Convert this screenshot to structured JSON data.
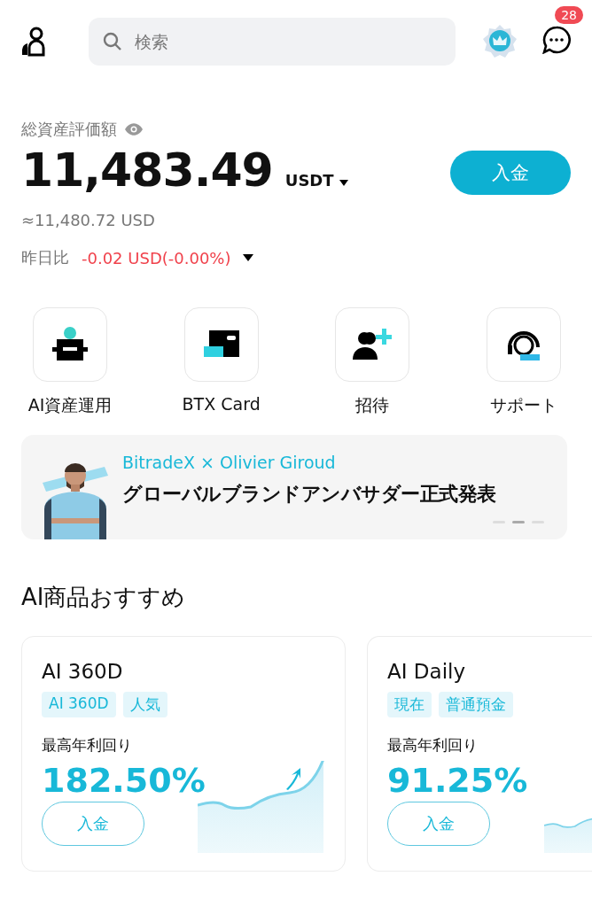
{
  "header": {
    "search": {
      "placeholder": "検索"
    },
    "notification_count": "28"
  },
  "balance": {
    "label": "総資産評価額",
    "amount": "11,483.49",
    "currency": "USDT",
    "approx": "≈11,480.72 USD",
    "change_label": "昨日比",
    "change": "-0.02 USD(-0.00%)",
    "deposit_button": "入金"
  },
  "shortcuts": [
    {
      "kind": "robot",
      "label": "AI資産運用"
    },
    {
      "kind": "card",
      "label": "BTX Card"
    },
    {
      "kind": "invite",
      "label": "招待"
    },
    {
      "kind": "support",
      "label": "サポート"
    }
  ],
  "banner": {
    "title": "BitradeX × Olivier Giroud",
    "subtitle": "グローバルブランドアンバサダー正式発表",
    "dots": [
      {
        "selected": false
      },
      {
        "selected": true
      },
      {
        "selected": false
      }
    ]
  },
  "section_title": "AI商品おすすめ",
  "products": [
    {
      "name": "AI 360D",
      "tags": [
        "AI 360D",
        "人気"
      ],
      "yield_label": "最高年利回り",
      "yield": "182.50%",
      "button": "入金"
    },
    {
      "name": "AI Daily",
      "tags": [
        "現在",
        "普通預金"
      ],
      "yield_label": "最高年利回り",
      "yield": "91.25%",
      "button": "入金"
    }
  ]
}
